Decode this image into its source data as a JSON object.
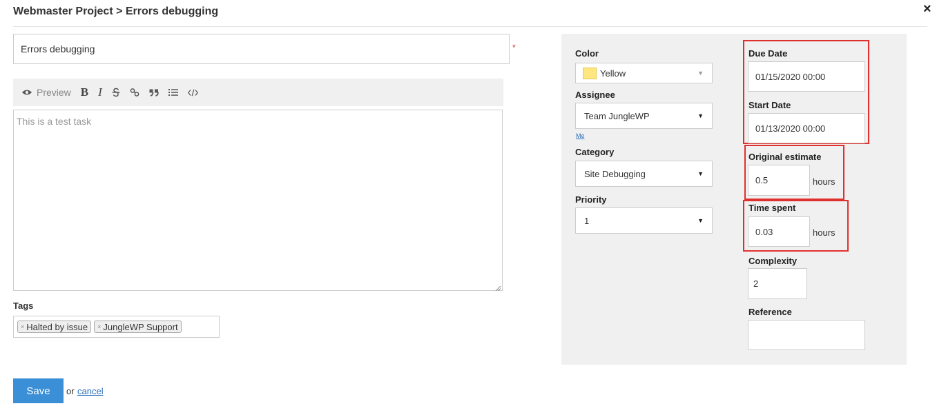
{
  "header": {
    "title": "Webmaster Project > Errors debugging",
    "close_icon": "×"
  },
  "task": {
    "name_value": "Errors debugging",
    "required_mark": "*",
    "description_placeholder": "This is a test task"
  },
  "toolbar": {
    "preview_label": "Preview",
    "bold_label": "B",
    "italic_label": "I",
    "strike_label": "S",
    "link_label": "%",
    "quote_label": "99",
    "list_label": "≡",
    "code_label": "</>"
  },
  "tags": {
    "label": "Tags",
    "items": [
      "Halted by issue",
      "JungleWP Support"
    ],
    "remove_glyph": "×"
  },
  "actions": {
    "save_label": "Save",
    "or_text": "or",
    "cancel_label": "cancel"
  },
  "details": {
    "color_label": "Color",
    "color_value": "Yellow",
    "color_swatch": "#ffe680",
    "assignee_label": "Assignee",
    "assignee_value": "Team JungleWP",
    "me_link": "Me",
    "category_label": "Category",
    "category_value": "Site Debugging",
    "priority_label": "Priority",
    "priority_value": "1",
    "due_date_label": "Due Date",
    "due_date_value": "01/15/2020 00:00",
    "start_date_label": "Start Date",
    "start_date_value": "01/13/2020 00:00",
    "original_estimate_label": "Original estimate",
    "original_estimate_value": "0.5",
    "original_estimate_unit": "hours",
    "time_spent_label": "Time spent",
    "time_spent_value": "0.03",
    "time_spent_unit": "hours",
    "complexity_label": "Complexity",
    "complexity_value": "2",
    "reference_label": "Reference",
    "reference_value": ""
  },
  "colors": {
    "save_button": "#3a8fd6",
    "highlight_border": "#e0302d",
    "panel_background": "#f0f0f0"
  }
}
